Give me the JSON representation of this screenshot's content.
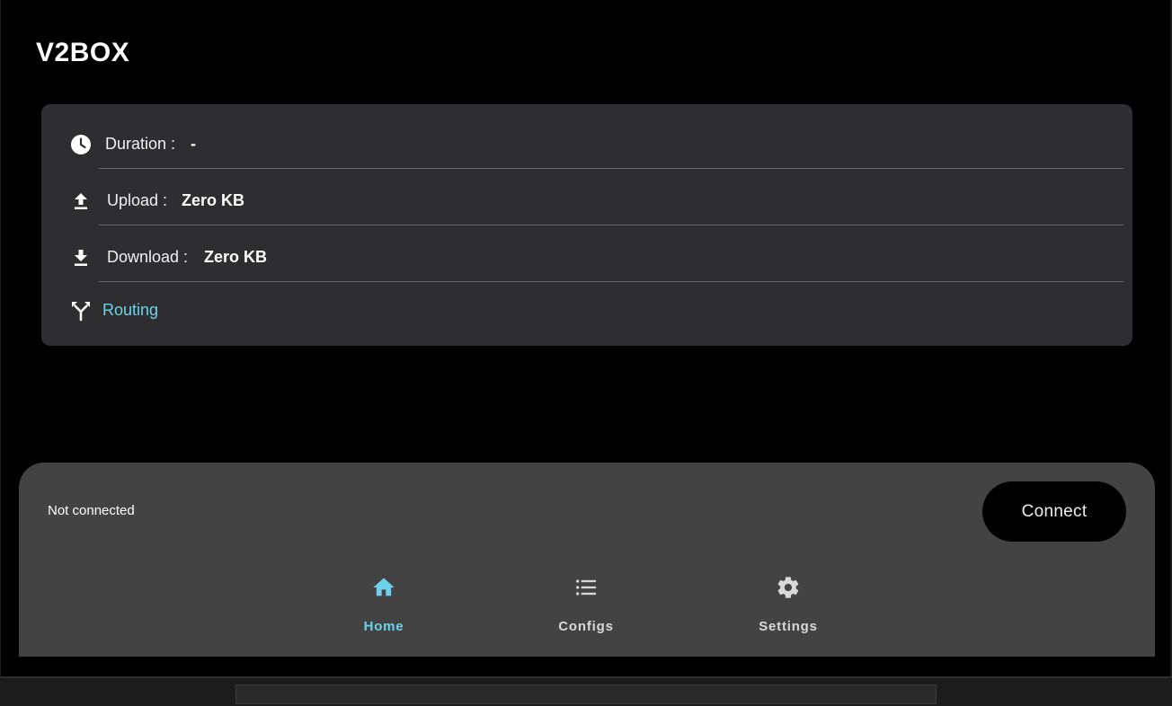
{
  "app": {
    "title": "V2BOX"
  },
  "stats": {
    "duration": {
      "label": "Duration :",
      "value": "-",
      "icon": "clock-icon"
    },
    "upload": {
      "label": "Upload :",
      "value": "Zero KB",
      "icon": "upload-icon"
    },
    "download": {
      "label": "Download :",
      "value": "Zero KB",
      "icon": "download-icon"
    },
    "routing": {
      "label": "Routing",
      "icon": "routing-icon"
    }
  },
  "connection": {
    "status": "Not connected",
    "button_label": "Connect"
  },
  "nav": {
    "items": [
      {
        "label": "Home",
        "icon": "home-icon",
        "active": true
      },
      {
        "label": "Configs",
        "icon": "list-icon",
        "active": false
      },
      {
        "label": "Settings",
        "icon": "gear-icon",
        "active": false
      }
    ]
  },
  "colors": {
    "accent": "#6cd2ec",
    "background": "#000000",
    "card": "#2e2e30",
    "panel": "#434343"
  }
}
